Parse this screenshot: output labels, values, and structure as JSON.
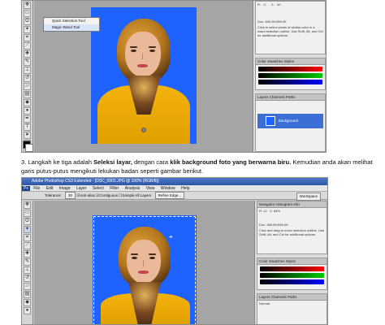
{
  "screenshot1": {
    "flyout": {
      "quick_selection": "Quick Selection Tool",
      "magic_wand": "Magic Wand Tool"
    },
    "info_text": "Doc: 489.0K/489.0K",
    "hint_text": "Click to select pixels of similar color in a wand selection outline. Use Shift, Alt, and Ctrl for additional options.",
    "color_tabs": "Color   Swatches   Styles",
    "layers_tabs": "Layers   Channels   Paths",
    "layer_name": "Background"
  },
  "instruction": {
    "number": "3.",
    "text1": " Langkah ke tiga adalah ",
    "bold1": "Seleksi layar,",
    "text2": " dengan cara ",
    "bold2": "klik background foto yang berwarna biru.",
    "text3": " Kemudian anda akan melihat garis putus-putus mengikuti lekukan badan seperti gambar berikut."
  },
  "screenshot2": {
    "title": "Adobe Photoshop CS3 Extended - [DSC_0001.JPG @ 100% (RGB/8)]",
    "menu": [
      "File",
      "Edit",
      "Image",
      "Layer",
      "Select",
      "Filter",
      "Analysis",
      "View",
      "Window",
      "Help"
    ],
    "options": {
      "tolerance_label": "Tolerance:",
      "tolerance_value": "30",
      "antialias": "Anti-alias",
      "contiguous": "Contiguous",
      "sample_all": "Sample All Layers",
      "refine_edge": "Refine Edge..."
    },
    "workspace": "Workspace",
    "panel_tabs": "Navigator   Histogram   Info",
    "info_text": "Doc: 489.0K/489.0K",
    "hint_text": "Click and drag to move selection outline. Use Shift, Alt, and Ctrl for additional options.",
    "color_tabs": "Color   Swatches   Styles",
    "layers_tabs": "Layers   Channels   Paths",
    "layers_mode": "Normal"
  },
  "colors": {
    "photo_bg": "#1e63ff",
    "jacket": "#f3b20c",
    "titlebar": "#2d56a5"
  }
}
